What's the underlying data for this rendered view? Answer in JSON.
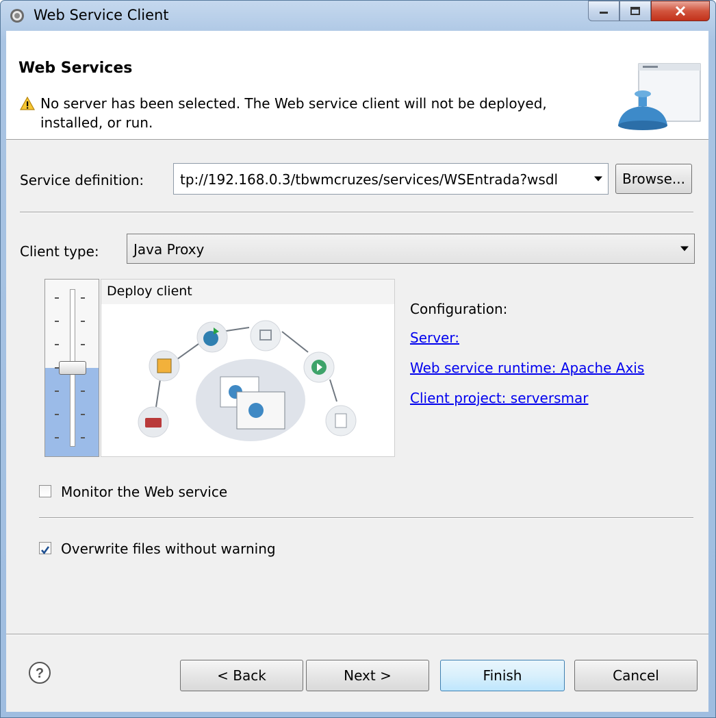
{
  "window": {
    "title": "Web Service Client"
  },
  "banner": {
    "title": "Web Services",
    "message": "No server has been selected. The Web service client will not be deployed, installed, or run."
  },
  "service_definition": {
    "label": "Service definition:",
    "value": "tp://192.168.0.3/tbwmcruzes/services/WSEntrada?wsdl",
    "browse_label": "Browse..."
  },
  "client_type": {
    "label": "Client type:",
    "value": "Java Proxy"
  },
  "slider": {
    "stage_label": "Deploy client",
    "level_fraction": 0.5
  },
  "configuration": {
    "heading": "Configuration:",
    "server_link": "Server: ",
    "runtime_link": "Web service runtime: Apache Axis",
    "project_link": "Client project: serversmar"
  },
  "options": {
    "monitor_label": "Monitor the Web service",
    "monitor_checked": false,
    "overwrite_label": "Overwrite files without warning",
    "overwrite_checked": true
  },
  "buttons": {
    "back": "< Back",
    "next": "Next >",
    "finish": "Finish",
    "cancel": "Cancel"
  },
  "icons": [
    "app-icon",
    "warning-icon",
    "wizard-banner-image",
    "help-icon",
    "minimize-icon",
    "maximize-icon",
    "close-icon"
  ],
  "colors": {
    "link": "#0000ee",
    "slider_fill": "#9bbbe8",
    "close_button": "#c2311a"
  }
}
